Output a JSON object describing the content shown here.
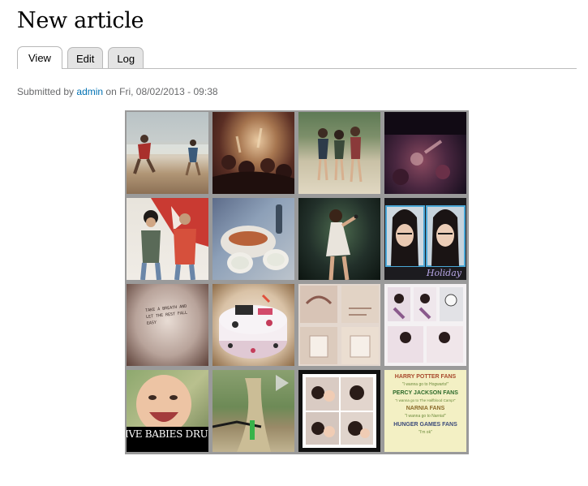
{
  "page": {
    "title": "New article"
  },
  "tabs": [
    {
      "label": "View",
      "active": true
    },
    {
      "label": "Edit",
      "active": false
    },
    {
      "label": "Log",
      "active": false
    }
  ],
  "meta": {
    "submitted_prefix": "Submitted by",
    "author": "admin",
    "on_text": "on",
    "date": "Fri, 08/02/2013 - 09:38"
  },
  "gallery": {
    "photos": [
      {
        "name": "beach-running"
      },
      {
        "name": "concert-crowd"
      },
      {
        "name": "three-girls-posing"
      },
      {
        "name": "dark-party"
      },
      {
        "name": "two-guys-red-poster"
      },
      {
        "name": "food-plates"
      },
      {
        "name": "stage-singer"
      },
      {
        "name": "holiday-selfies",
        "caption": "Holiday"
      },
      {
        "name": "note-card",
        "caption": "TAKE A BREATH AND LET THE REST FALL EASY"
      },
      {
        "name": "decorated-cake"
      },
      {
        "name": "love-collage"
      },
      {
        "name": "friends-collage"
      },
      {
        "name": "laughing-baby",
        "caption": "IVE BABIES DRUG"
      },
      {
        "name": "bike-trail"
      },
      {
        "name": "couple-grid"
      },
      {
        "name": "fandom-text",
        "lines": [
          "HARRY POTTER FANS",
          "\"I wanna go to Hogwarts!\"",
          "PERCY JACKSON FANS",
          "\"I wanna go to The Halfblood Camp!\"",
          "NARNIA FANS",
          "\"I wanna go to Narnia!\"",
          "HUNGER GAMES FANS",
          "\"I'm ok\""
        ]
      }
    ]
  }
}
